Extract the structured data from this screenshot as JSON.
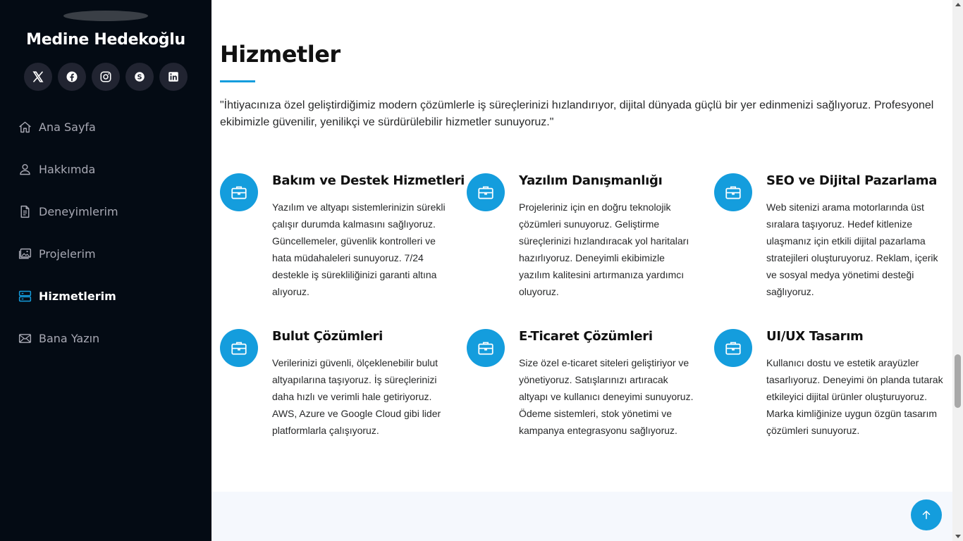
{
  "profile": {
    "name": "Medine Hedekoğlu"
  },
  "social": [
    {
      "icon": "x-twitter-icon"
    },
    {
      "icon": "facebook-icon"
    },
    {
      "icon": "instagram-icon"
    },
    {
      "icon": "skype-icon"
    },
    {
      "icon": "linkedin-icon"
    }
  ],
  "nav": {
    "items": [
      {
        "label": "Ana Sayfa",
        "icon": "home-icon"
      },
      {
        "label": "Hakkımda",
        "icon": "person-icon"
      },
      {
        "label": "Deneyimlerim",
        "icon": "file-text-icon"
      },
      {
        "label": "Projelerim",
        "icon": "images-icon"
      },
      {
        "label": "Hizmetlerim",
        "icon": "server-icon",
        "active": true
      },
      {
        "label": "Bana Yazın",
        "icon": "envelope-icon"
      }
    ]
  },
  "section": {
    "title": "Hizmetler",
    "intro": "\"İhtiyacınıza özel geliştirdiğimiz modern çözümlerle iş süreçlerinizi hızlandırıyor, dijital dünyada güçlü bir yer edinmenizi sağlıyoruz. Profesyonel ekibimizle güvenilir, yenilikçi ve sürdürülebilir hizmetler sunuyoruz.\""
  },
  "services": [
    {
      "title": "Bakım ve Destek Hizmetleri",
      "description": "Yazılım ve altyapı sistemlerinizin sürekli çalışır durumda kalmasını sağlıyoruz. Güncellemeler, güvenlik kontrolleri ve hata müdahaleleri sunuyoruz. 7/24 destekle iş sürekliliğinizi garanti altına alıyoruz.",
      "icon": "briefcase-icon"
    },
    {
      "title": "Yazılım Danışmanlığı",
      "description": "Projeleriniz için en doğru teknolojik çözümleri sunuyoruz. Geliştirme süreçlerinizi hızlandıracak yol haritaları hazırlıyoruz. Deneyimli ekibimizle yazılım kalitesini artırmanıza yardımcı oluyoruz.",
      "icon": "briefcase-icon"
    },
    {
      "title": "SEO ve Dijital Pazarlama",
      "description": "Web sitenizi arama motorlarında üst sıralara taşıyoruz. Hedef kitlenize ulaşmanız için etkili dijital pazarlama stratejileri oluşturuyoruz. Reklam, içerik ve sosyal medya yönetimi desteği sağlıyoruz.",
      "icon": "briefcase-icon"
    },
    {
      "title": "Bulut Çözümleri",
      "description": "Verilerinizi güvenli, ölçeklenebilir bulut altyapılarına taşıyoruz. İş süreçlerinizi daha hızlı ve verimli hale getiriyoruz. AWS, Azure ve Google Cloud gibi lider platformlarla çalışıyoruz.",
      "icon": "briefcase-icon"
    },
    {
      "title": "E-Ticaret Çözümleri",
      "description": "Size özel e-ticaret siteleri geliştiriyor ve yönetiyoruz. Satışlarınızı artıracak altyapı ve kullanıcı deneyimi sunuyoruz. Ödeme sistemleri, stok yönetimi ve kampanya entegrasyonu sağlıyoruz.",
      "icon": "briefcase-icon"
    },
    {
      "title": "UI/UX Tasarım",
      "description": "Kullanıcı dostu ve estetik arayüzler tasarlıyoruz. Deneyimi ön planda tutarak etkileyici dijital ürünler oluşturuyoruz. Marka kimliğinize uygun özgün tasarım çözümleri sunuyoruz.",
      "icon": "briefcase-icon"
    }
  ],
  "scroll_top": {
    "icon": "arrow-up-icon"
  },
  "colors": {
    "accent": "#149ddd",
    "sidebar_bg": "#040b14",
    "social_bg": "#212431",
    "nav_text": "#a8a9b4"
  }
}
